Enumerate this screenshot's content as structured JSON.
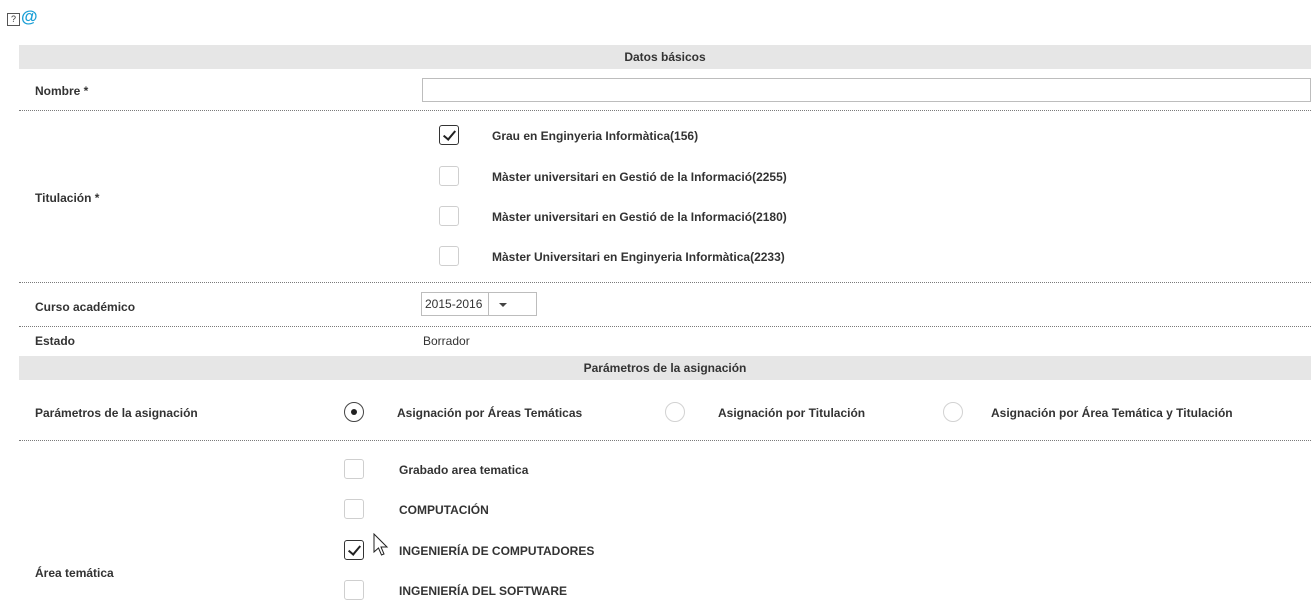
{
  "top_icons": {
    "help": "?",
    "email": "@"
  },
  "section1": {
    "title": "Datos básicos",
    "nombre": {
      "label": "Nombre *",
      "value": ""
    },
    "titulacion": {
      "label": "Titulación *",
      "options": [
        {
          "label": "Grau en Enginyeria Informàtica(156)",
          "checked": true
        },
        {
          "label": "Màster universitari en Gestió de la Informació(2255)",
          "checked": false
        },
        {
          "label": "Màster universitari en Gestió de la Informació(2180)",
          "checked": false
        },
        {
          "label": "Màster Universitari en Enginyeria Informàtica(2233)",
          "checked": false
        }
      ]
    },
    "curso": {
      "label": "Curso académico",
      "value": "2015-2016"
    },
    "estado": {
      "label": "Estado",
      "value": "Borrador"
    }
  },
  "section2": {
    "title": "Parámetros de la asignación",
    "param_label": "Parámetros de la asignación",
    "radios": [
      {
        "label": "Asignación por Áreas Temáticas",
        "checked": true
      },
      {
        "label": "Asignación por Titulación",
        "checked": false
      },
      {
        "label": "Asignación por Área Temática y Titulación",
        "checked": false
      }
    ],
    "area": {
      "label": "Área temática",
      "options": [
        {
          "label": "Grabado area tematica",
          "checked": false
        },
        {
          "label": "COMPUTACIÓN",
          "checked": false
        },
        {
          "label": "INGENIERÍA DE COMPUTADORES",
          "checked": true
        },
        {
          "label": "INGENIERÍA DEL SOFTWARE",
          "checked": false
        }
      ]
    }
  }
}
